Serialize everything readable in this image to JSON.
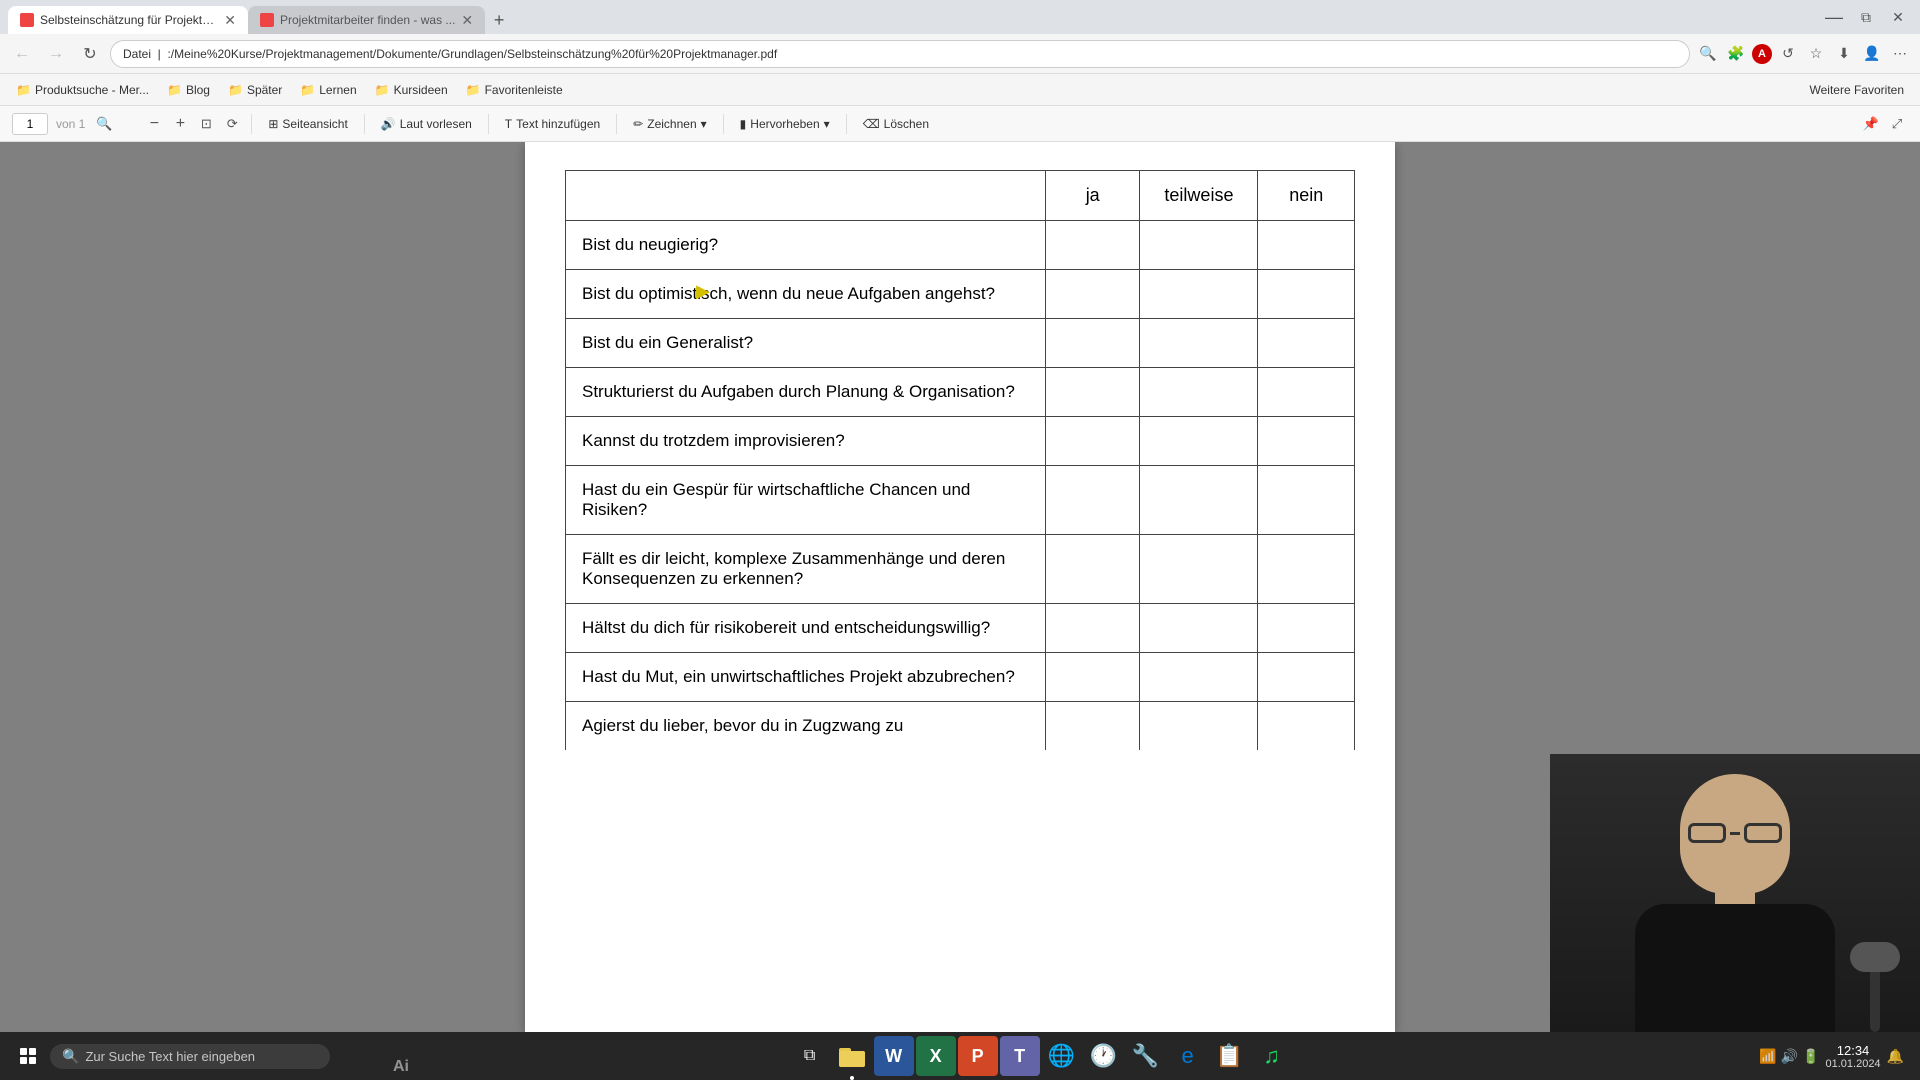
{
  "browser": {
    "tabs": [
      {
        "id": "tab1",
        "title": "Selbsteinschätzung für Projektm...",
        "active": true,
        "favicon_color": "#e44"
      },
      {
        "id": "tab2",
        "title": "Projektmitarbeiter finden - was ...",
        "active": false,
        "favicon_color": "#e44"
      }
    ],
    "address": "Datei | :/Meine%20Kurse/Projektmanagement/Dokumente/Grundlagen/Selbsteinschätzung%20für%20Projektmanager.pdf",
    "address_short": "Datei   :/Meine%20Kurse/Projektmanagement/Dokumente/Grundlagen/Selbsteinschätzung%20für%20Projektmanager.pdf"
  },
  "bookmarks": [
    {
      "label": "Produktsuche - Mer...",
      "icon": "📁"
    },
    {
      "label": "Blog",
      "icon": "📁"
    },
    {
      "label": "Später",
      "icon": "📁"
    },
    {
      "label": "Lernen",
      "icon": "📁"
    },
    {
      "label": "Kursideen",
      "icon": "📁"
    },
    {
      "label": "Favoritenleiste",
      "icon": "📁"
    }
  ],
  "weitere_favoriten": "Weitere Favoriten",
  "pdf_toolbar": {
    "page_current": "1",
    "page_total": "von 1",
    "zoom_minus": "−",
    "zoom_plus": "+",
    "seitenansicht": "Seiteansicht",
    "laut_vorlesen": "Laut vorlesen",
    "text_hinzufuegen": "Text hinzufügen",
    "zeichnen": "Zeichnen",
    "hervorheben": "Hervorheben",
    "loeschen": "Löschen"
  },
  "table": {
    "header": {
      "col1": "",
      "col2": "ja",
      "col3": "teilweise",
      "col4": "nein"
    },
    "rows": [
      {
        "question": "Bist du neugierig?",
        "ja": "",
        "teilweise": "",
        "nein": ""
      },
      {
        "question": "Bist du optimistisch, wenn du neue Aufgaben angehst?",
        "ja": "",
        "teilweise": "",
        "nein": ""
      },
      {
        "question": "Bist du ein Generalist?",
        "ja": "",
        "teilweise": "",
        "nein": ""
      },
      {
        "question": "Strukturierst du Aufgaben durch Planung & Organisation?",
        "ja": "",
        "teilweise": "",
        "nein": ""
      },
      {
        "question": "Kannst du trotzdem improvisieren?",
        "ja": "",
        "teilweise": "",
        "nein": ""
      },
      {
        "question": "Hast du ein Gespür für wirtschaftliche Chancen und Risiken?",
        "ja": "",
        "teilweise": "",
        "nein": ""
      },
      {
        "question": "Fällt es dir leicht, komplexe Zusammenhänge und deren Konsequenzen zu erkennen?",
        "ja": "",
        "teilweise": "",
        "nein": ""
      },
      {
        "question": "Hältst du dich für risikobereit und entscheidungswillig?",
        "ja": "",
        "teilweise": "",
        "nein": ""
      },
      {
        "question": "Hast du Mut, ein unwirtschaftliches Projekt abzubrechen?",
        "ja": "",
        "teilweise": "",
        "nein": ""
      },
      {
        "question": "Agierst du lieber, bevor du in Zugzwang zu",
        "ja": "",
        "teilweise": "",
        "nein": ""
      }
    ]
  },
  "taskbar": {
    "search_placeholder": "Zur Suche Text hier eingeben",
    "time": "12:34",
    "date": "01.01.2024",
    "apps": [
      {
        "name": "windows-start",
        "icon": "⊞"
      },
      {
        "name": "file-explorer",
        "icon": "📁"
      },
      {
        "name": "word",
        "icon": "W"
      },
      {
        "name": "excel",
        "icon": "X"
      },
      {
        "name": "powerpoint",
        "icon": "P"
      },
      {
        "name": "teams",
        "icon": "T"
      },
      {
        "name": "chrome",
        "icon": "🌐"
      },
      {
        "name": "spotify",
        "icon": "♪"
      }
    ]
  },
  "ai_label": "Ai"
}
